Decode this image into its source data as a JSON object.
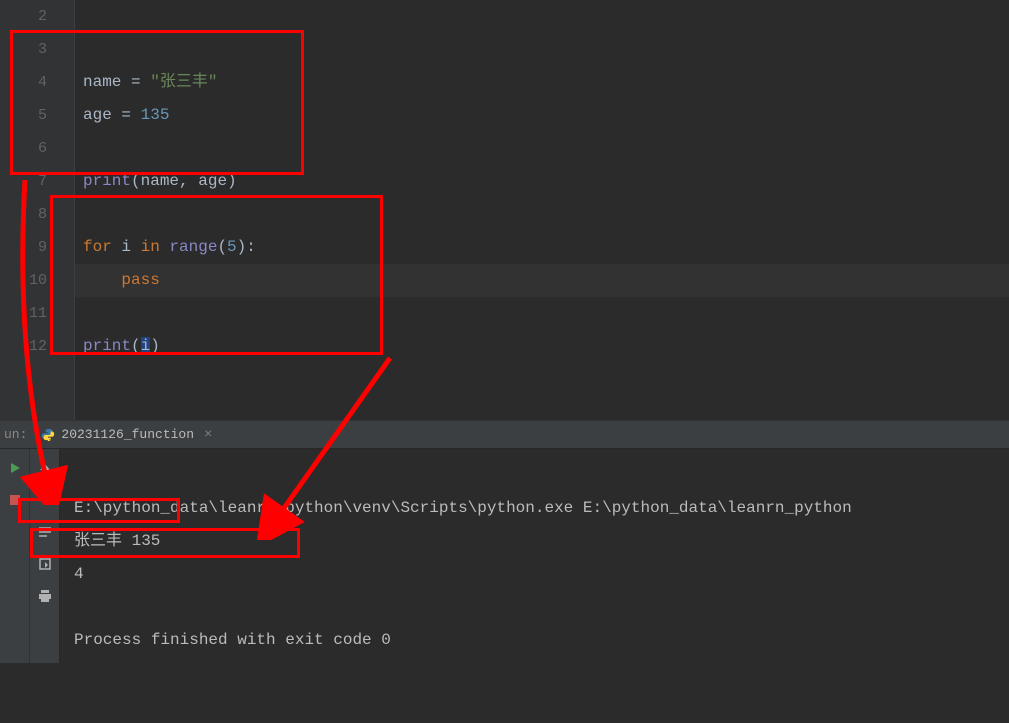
{
  "gutter": {
    "l2": "2",
    "l3": "3",
    "l4": "4",
    "l5": "5",
    "l6": "6",
    "l7": "7",
    "l8": "8",
    "l9": "9",
    "l10": "10",
    "l11": "11",
    "l12": "12"
  },
  "code": {
    "line3": {
      "a": "name ",
      "b": "= ",
      "c": "\"张三丰\""
    },
    "line4": {
      "a": "age ",
      "b": "= ",
      "c": "135"
    },
    "line6": {
      "a": "print",
      "b": "(name",
      "c": ", ",
      "d": "age)"
    },
    "line8": {
      "a": "for ",
      "b": "i ",
      "c": "in ",
      "d": "range",
      "e": "(",
      "f": "5",
      "g": "):"
    },
    "line9": {
      "a": "    ",
      "b": "pass"
    },
    "line11": {
      "a": "print",
      "b": "(",
      "c": "i",
      "d": ")"
    }
  },
  "run": {
    "label": "un:",
    "tab_name": "20231126_function",
    "console_line1": "E:\\python_data\\leanrn_python\\venv\\Scripts\\python.exe E:\\python_data\\leanrn_python",
    "console_line2": "张三丰 135",
    "console_line3": "4",
    "console_line5": "Process finished with exit code 0"
  }
}
